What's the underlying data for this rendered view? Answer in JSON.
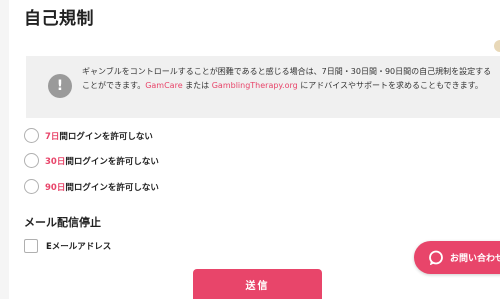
{
  "header": {
    "title": "自己規制"
  },
  "notice": {
    "icon": "exclamation-icon",
    "text_before": "ギャンブルをコントロールすることが困難であると感じる場合は、7日間・30日間・90日間の自己規制を設定することができます。",
    "link1": "GamCare",
    "text_middle": " または ",
    "link2": "GamblingTherapy.org",
    "text_after": " にアドバイスやサポートを求めることもできます。"
  },
  "self_exclusion": {
    "options": [
      {
        "num": "7日",
        "rest": "間ログインを許可しない"
      },
      {
        "num": "30日",
        "rest": "間ログインを許可しない"
      },
      {
        "num": "90日",
        "rest": "間ログインを許可しない"
      }
    ]
  },
  "mail": {
    "section_title": "メール配信停止",
    "checkbox_label": "Eメールアドレス"
  },
  "actions": {
    "submit_label": "送信"
  },
  "chat": {
    "label": "お問い合わせ"
  },
  "colors": {
    "accent": "#e8456a",
    "notice_bg": "#f0f0f0",
    "icon_gray": "#9a9a9a"
  }
}
